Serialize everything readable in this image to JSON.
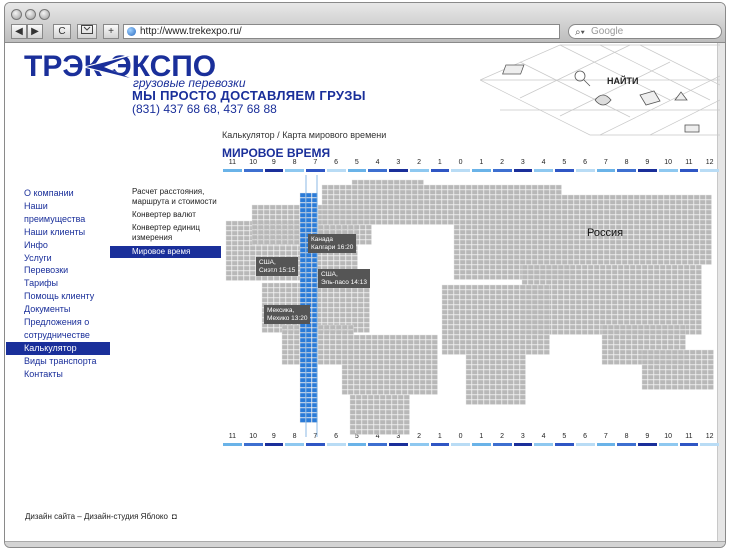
{
  "browser": {
    "url": "http://www.trekexpo.ru/",
    "search_placeholder": "Google",
    "back": "◀",
    "forward": "▶",
    "reload": "C",
    "add": "+"
  },
  "header": {
    "logo": "ТРЭК ЭКСПО",
    "logo_sub": "грузовые перевозки",
    "slogan": "МЫ ПРОСТО ДОСТАВЛЯЕМ ГРУЗЫ",
    "phones": "(831) 437 68 68, 437 68 88",
    "find": "НАЙТИ"
  },
  "breadcrumb": "Калькулятор / Карта мирового времени",
  "page_title": "МИРОВОЕ ВРЕМЯ",
  "nav": [
    {
      "label": "О компании",
      "active": false
    },
    {
      "label": "Наши преимущества",
      "active": false
    },
    {
      "label": "Наши клиенты",
      "active": false
    },
    {
      "label": "Инфо",
      "active": false
    },
    {
      "label": "Услуги",
      "active": false
    },
    {
      "label": "Перевозки",
      "active": false
    },
    {
      "label": "Тарифы",
      "active": false
    },
    {
      "label": "Помощь клиенту",
      "active": false
    },
    {
      "label": "Документы",
      "active": false
    },
    {
      "label": "Предложения о сотрудничестве",
      "active": false
    },
    {
      "label": "Калькулятор",
      "active": true
    },
    {
      "label": "Виды транспорта",
      "active": false
    },
    {
      "label": "Контакты",
      "active": false
    }
  ],
  "subnav": [
    {
      "label": "Расчет расстояния, маршрута и стоимости",
      "active": false
    },
    {
      "label": "Конвертер валют",
      "active": false
    },
    {
      "label": "Конвертер единиц измерения",
      "active": false
    },
    {
      "label": "Мировое время",
      "active": true
    }
  ],
  "timezones": [
    "11",
    "10",
    "9",
    "8",
    "7",
    "6",
    "5",
    "4",
    "3",
    "2",
    "1",
    "0",
    "1",
    "2",
    "3",
    "4",
    "5",
    "6",
    "7",
    "8",
    "9",
    "10",
    "11",
    "12"
  ],
  "map": {
    "region_label": "Россия",
    "cities": [
      {
        "line1": "Канада",
        "line2": "Калгари 16:20"
      },
      {
        "line1": "США,",
        "line2": "Сиэтл 15:15"
      },
      {
        "line1": "США,",
        "line2": "Эль-пасо 14:13"
      },
      {
        "line1": "Мексика,",
        "line2": "Мехико 13:20"
      }
    ]
  },
  "footer": {
    "credit": "Дизайн сайта – Дизайн-студия Яблоко",
    "apple": "◘"
  },
  "colors": {
    "brand": "#1a2f9a",
    "highlight": "#2a7bd8",
    "land": "#b8b8b8"
  }
}
